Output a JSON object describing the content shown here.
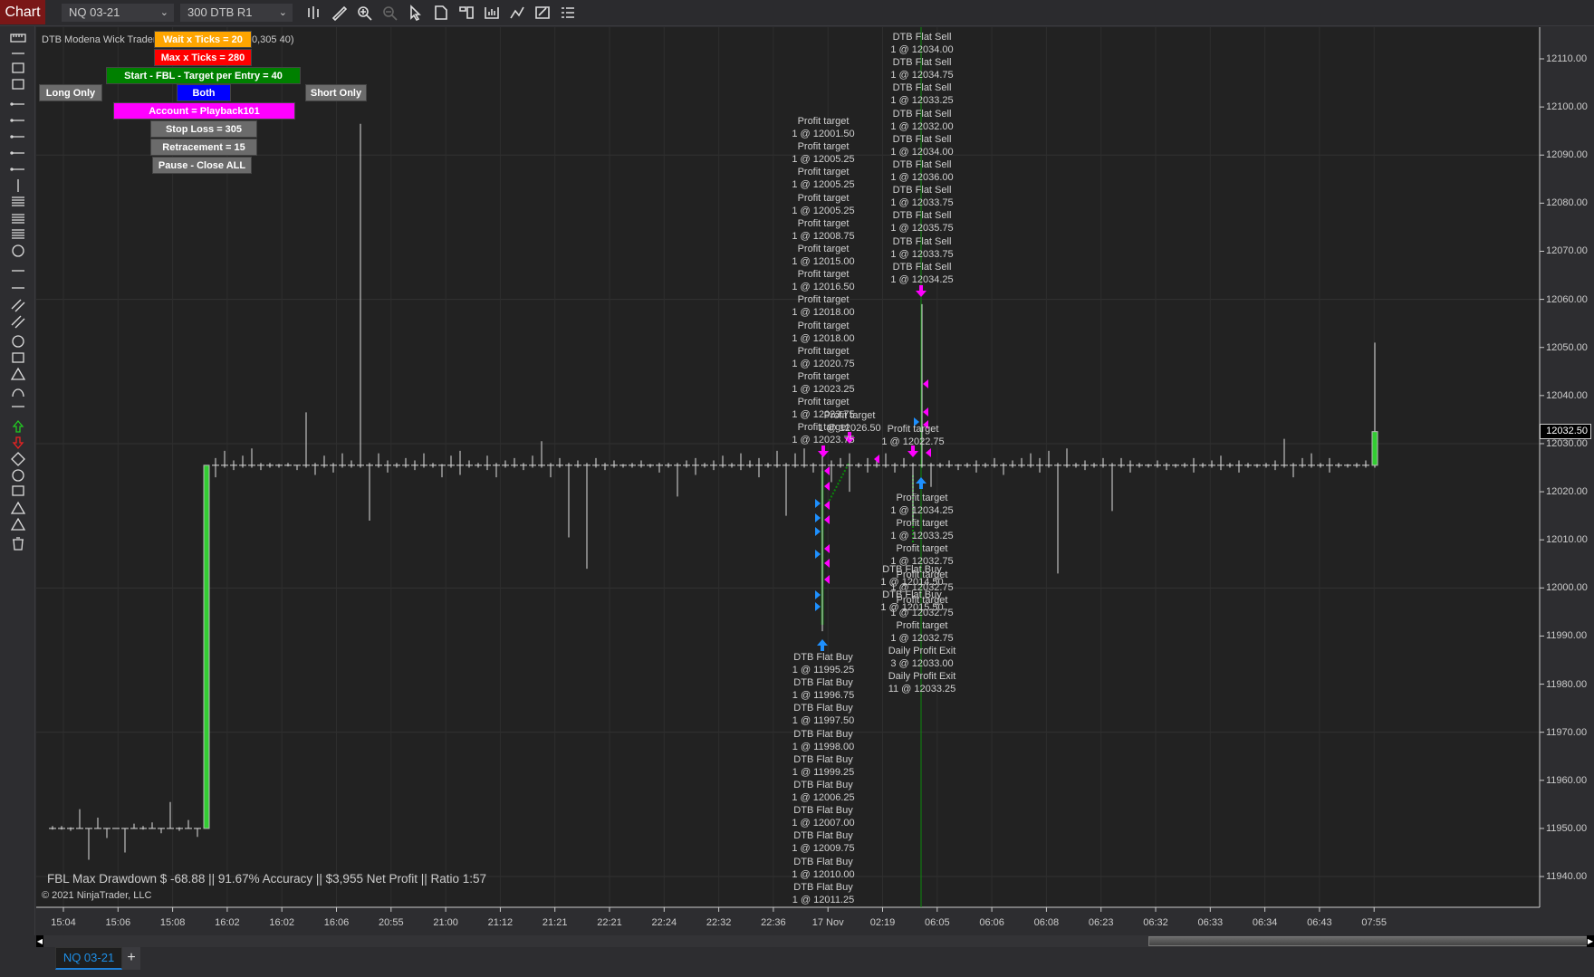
{
  "topbar": {
    "app_button": "Chart",
    "instrument": "NQ 03-21",
    "bar_type": "300 DTB R1",
    "icons": [
      "bar-chart-icon",
      "pencil-icon",
      "zoom-in-icon",
      "zoom-out-icon",
      "pointer-icon",
      "properties-icon",
      "data-box-icon",
      "chart-trader-icon",
      "indicators-icon",
      "strategies-icon",
      "list-icon"
    ]
  },
  "left_toolbar": {
    "icons": [
      "ruler-icon",
      "risk-reward-icon",
      "region-vertical-icon",
      "region-horizontal-icon",
      "line-icon",
      "ray-icon",
      "extended-line-icon",
      "arrow-line-icon",
      "horizontal-line-icon",
      "vertical-line-icon",
      "fib-retracement-icon",
      "fib-extension-icon",
      "fib-time-icon",
      "fib-circle-icon",
      "andrews-pitchfork-icon",
      "gann-fan-icon",
      "regression-channel-icon",
      "trend-channel-icon",
      "ellipse-icon",
      "rectangle-icon",
      "triangle-icon",
      "arc-icon",
      "text-icon",
      "arrow-up-icon",
      "arrow-down-icon",
      "diamond-icon",
      "dot-icon",
      "square-icon",
      "triangle-up-icon",
      "triangle-down-icon",
      "trash-icon"
    ]
  },
  "indicator": {
    "label_left": "DTB Modena Wick Trader,",
    "label_right": "0,305 40)"
  },
  "panel": {
    "wait_ticks": "Wait x Ticks = 20",
    "max_ticks": "Max x Ticks = 280",
    "start": "Start - FBL - Target per Entry = 40",
    "long_only": "Long Only",
    "both": "Both",
    "short_only": "Short Only",
    "account": "Account = Playback101",
    "stop_loss": "Stop Loss = 305",
    "retracement": "Retracement = 15",
    "pause": "Pause - Close ALL"
  },
  "colors": {
    "wait": "#ffa500",
    "max": "#ff0000",
    "start": "#008000",
    "both": "#0000ff",
    "account": "#ff00ff",
    "grey_button": "#6b6b6b",
    "up_bar": "#33cc33",
    "sell_marker": "#ff00ff",
    "buy_marker": "#1e90ff",
    "background": "#222222"
  },
  "price_axis": {
    "ticks": [
      "12110.00",
      "12100.00",
      "12090.00",
      "12080.00",
      "12070.00",
      "12060.00",
      "12050.00",
      "12040.00",
      "12030.00",
      "12020.00",
      "12010.00",
      "12000.00",
      "11990.00",
      "11980.00",
      "11970.00",
      "11960.00",
      "11950.00",
      "11940.00"
    ],
    "current_price": "12032.50"
  },
  "time_axis": [
    "15:04",
    "15:06",
    "15:08",
    "16:02",
    "16:02",
    "16:06",
    "20:55",
    "21:00",
    "21:12",
    "21:21",
    "22:21",
    "22:24",
    "22:32",
    "22:36",
    "17 Nov",
    "02:19",
    "06:05",
    "06:06",
    "06:08",
    "06:23",
    "06:32",
    "06:33",
    "06:34",
    "06:43",
    "07:55"
  ],
  "bars": [
    [
      11950,
      11950.5,
      11949.75,
      11950
    ],
    [
      11950,
      11950.5,
      11949.75,
      11950
    ],
    [
      11950,
      11950.25,
      11949.5,
      11950
    ],
    [
      11950,
      11954,
      11950,
      11950
    ],
    [
      11950,
      11950,
      11943.5,
      11950
    ],
    [
      11950,
      11952.25,
      11950,
      11950
    ],
    [
      11950,
      11950,
      11948,
      11950
    ],
    [
      11950,
      11950,
      11950,
      11950
    ],
    [
      11950,
      11950,
      11945,
      11950
    ],
    [
      11950,
      11951,
      11950,
      11950
    ],
    [
      11950,
      11950.5,
      11949.75,
      11950
    ],
    [
      11950,
      11951.25,
      11950,
      11950
    ],
    [
      11950,
      11950,
      11949,
      11950
    ],
    [
      11950,
      11955.5,
      11950,
      11950
    ],
    [
      11950,
      11950.25,
      11949.5,
      11950
    ],
    [
      11950,
      11951.75,
      11950,
      11950
    ],
    [
      11950,
      11950,
      11948.25,
      11950
    ],
    [
      11950,
      12025.5,
      11950,
      12025.5
    ],
    [
      12025.5,
      12027,
      12023,
      12025.5
    ],
    [
      12025.5,
      12028.5,
      12025,
      12025.5
    ],
    [
      12025.5,
      12026.5,
      12024.5,
      12025.5
    ],
    [
      12025.5,
      12027.5,
      12025,
      12025.5
    ],
    [
      12025.5,
      12029,
      12025,
      12025.5
    ],
    [
      12025.5,
      12026,
      12024.5,
      12025.5
    ],
    [
      12025.5,
      12026,
      12025,
      12025.5
    ],
    [
      12025.5,
      12025.75,
      12025,
      12025.5
    ],
    [
      12025.5,
      12026,
      12025.25,
      12025.5
    ],
    [
      12025.5,
      12025.5,
      12024.5,
      12025.5
    ],
    [
      12025.5,
      12036.5,
      12025,
      12025.5
    ],
    [
      12025.5,
      12026,
      12023.5,
      12025.5
    ],
    [
      12025.5,
      12027.5,
      12025,
      12025.5
    ],
    [
      12025.5,
      12026,
      12024,
      12025.5
    ],
    [
      12025.5,
      12028,
      12025,
      12025.5
    ],
    [
      12025.5,
      12026.5,
      12025,
      12025.5
    ],
    [
      12025.5,
      12096.5,
      12025,
      12025.5
    ],
    [
      12025.5,
      12026,
      12014,
      12025.5
    ],
    [
      12025.5,
      12028,
      12025,
      12025.5
    ],
    [
      12025.5,
      12026.5,
      12024,
      12025.5
    ],
    [
      12025.5,
      12026,
      12025,
      12025.5
    ],
    [
      12025.5,
      12027,
      12025,
      12025.5
    ],
    [
      12025.5,
      12026.5,
      12024.5,
      12025.5
    ],
    [
      12025.5,
      12028,
      12025,
      12025.5
    ],
    [
      12025.5,
      12026,
      12025,
      12025.5
    ],
    [
      12025.5,
      12025.75,
      12023,
      12025.5
    ],
    [
      12025.5,
      12027.5,
      12025,
      12025.5
    ],
    [
      12025.5,
      12028.5,
      12023.5,
      12025.5
    ],
    [
      12025.5,
      12026.5,
      12025,
      12025.5
    ],
    [
      12025.5,
      12026,
      12025,
      12025.5
    ],
    [
      12025.5,
      12027.5,
      12024.5,
      12025.5
    ],
    [
      12025.5,
      12026,
      12023,
      12025.5
    ],
    [
      12025.5,
      12026.5,
      12025,
      12025.5
    ],
    [
      12025.5,
      12027,
      12025,
      12025.5
    ],
    [
      12025.5,
      12026,
      12024.5,
      12025.5
    ],
    [
      12025.5,
      12027.5,
      12025,
      12025.5
    ],
    [
      12025.5,
      12030.5,
      12025,
      12025.5
    ],
    [
      12025.5,
      12026,
      12023,
      12025.5
    ],
    [
      12025.5,
      12027,
      12025,
      12025.5
    ],
    [
      12025.5,
      12026,
      12010.5,
      12025.5
    ],
    [
      12025.5,
      12026.5,
      12025,
      12025.5
    ],
    [
      12025.5,
      12026,
      12004,
      12025.5
    ],
    [
      12025.5,
      12027,
      12025,
      12025.5
    ],
    [
      12025.5,
      12026,
      12024.5,
      12025.5
    ],
    [
      12025.5,
      12026.5,
      12025,
      12025.5
    ],
    [
      12025.5,
      12025.75,
      12025,
      12025.5
    ],
    [
      12025.5,
      12026,
      12025,
      12025.5
    ],
    [
      12025.5,
      12026.5,
      12025,
      12025.5
    ],
    [
      12025.5,
      12025.75,
      12025,
      12025.5
    ],
    [
      12025.5,
      12026,
      12024,
      12025.5
    ],
    [
      12025.5,
      12026,
      12025,
      12025.5
    ],
    [
      12025.5,
      12026,
      12019,
      12025.5
    ],
    [
      12025.5,
      12026.5,
      12025,
      12025.5
    ],
    [
      12025.5,
      12027,
      12023.5,
      12025.5
    ],
    [
      12025.5,
      12026,
      12025,
      12025.5
    ],
    [
      12025.5,
      12026.5,
      12024.5,
      12025.5
    ],
    [
      12025.5,
      12027.5,
      12025,
      12025.5
    ],
    [
      12025.5,
      12026,
      12025,
      12025.5
    ],
    [
      12025.5,
      12028,
      12024.5,
      12025.5
    ],
    [
      12025.5,
      12026.5,
      12025,
      12025.5
    ],
    [
      12025.5,
      12027,
      12023,
      12025.5
    ],
    [
      12025.5,
      12026,
      12025,
      12025.5
    ],
    [
      12025.5,
      12028.5,
      12025,
      12025.5
    ],
    [
      12025.5,
      12026,
      12015,
      12025.5
    ],
    [
      12025.5,
      12028,
      12025,
      12025.5
    ],
    [
      12025.5,
      12029,
      12025,
      12025.5
    ],
    [
      12025.5,
      12026,
      12024,
      12025.5
    ],
    [
      12025.5,
      12028,
      11991,
      12025.5
    ],
    [
      12025.5,
      12026.5,
      12022,
      12025.5
    ],
    [
      12025.5,
      12027,
      12025,
      12025.5
    ],
    [
      12025.5,
      12028,
      12020,
      12025.5
    ],
    [
      12025.5,
      12026,
      12025,
      12025.5
    ],
    [
      12025.5,
      12027,
      12024,
      12025.5
    ],
    [
      12025.5,
      12026.5,
      12025,
      12025.5
    ],
    [
      12025.5,
      12028,
      12025,
      12025.5
    ],
    [
      12025.5,
      12026,
      12024,
      12025.5
    ],
    [
      12025.5,
      12027,
      12025,
      12025.5
    ],
    [
      12025.5,
      12026,
      12014,
      12025.5
    ],
    [
      12025.5,
      12059,
      12025,
      12025.5
    ],
    [
      12025.5,
      12026,
      12021,
      12025.5
    ],
    [
      12025.5,
      12026,
      12025,
      12025.5
    ],
    [
      12025.5,
      12026.5,
      12025,
      12025.5
    ],
    [
      12025.5,
      12025.75,
      12024.5,
      12025.5
    ],
    [
      12025.5,
      12026,
      12025,
      12025.5
    ],
    [
      12025.5,
      12026.5,
      12024,
      12025.5
    ],
    [
      12025.5,
      12026,
      12025,
      12025.5
    ],
    [
      12025.5,
      12027,
      12025,
      12025.5
    ],
    [
      12025.5,
      12026,
      12023.5,
      12025.5
    ],
    [
      12025.5,
      12026.5,
      12025,
      12025.5
    ],
    [
      12025.5,
      12027,
      12025,
      12025.5
    ],
    [
      12025.5,
      12028,
      12025,
      12025.5
    ],
    [
      12025.5,
      12027,
      12024,
      12025.5
    ],
    [
      12025.5,
      12028.5,
      12025,
      12025.5
    ],
    [
      12025.5,
      12026,
      12003,
      12025.5
    ],
    [
      12025.5,
      12029,
      12025,
      12025.5
    ],
    [
      12025.5,
      12026,
      12025,
      12025.5
    ],
    [
      12025.5,
      12026.5,
      12024.5,
      12025.5
    ],
    [
      12025.5,
      12026,
      12025,
      12025.5
    ],
    [
      12025.5,
      12027,
      12025,
      12025.5
    ],
    [
      12025.5,
      12026,
      12016,
      12025.5
    ],
    [
      12025.5,
      12027,
      12025,
      12025.5
    ],
    [
      12025.5,
      12026.5,
      12024,
      12025.5
    ],
    [
      12025.5,
      12026,
      12025,
      12025.5
    ],
    [
      12025.5,
      12025.75,
      12025,
      12025.5
    ],
    [
      12025.5,
      12026.5,
      12025,
      12025.5
    ],
    [
      12025.5,
      12026,
      12024.5,
      12025.5
    ],
    [
      12025.5,
      12025.75,
      12025,
      12025.5
    ],
    [
      12025.5,
      12026,
      12025,
      12025.5
    ],
    [
      12025.5,
      12027,
      12024,
      12025.5
    ],
    [
      12025.5,
      12026,
      12025,
      12025.5
    ],
    [
      12025.5,
      12026.5,
      12025,
      12025.5
    ],
    [
      12025.5,
      12027.5,
      12024.5,
      12025.5
    ],
    [
      12025.5,
      12026,
      12025,
      12025.5
    ],
    [
      12025.5,
      12026.5,
      12024,
      12025.5
    ],
    [
      12025.5,
      12026,
      12025,
      12025.5
    ],
    [
      12025.5,
      12025.75,
      12025,
      12025.5
    ],
    [
      12025.5,
      12026,
      12025,
      12025.5
    ],
    [
      12025.5,
      12026.5,
      12024.5,
      12025.5
    ],
    [
      12025.5,
      12031,
      12025,
      12025.5
    ],
    [
      12025.5,
      12026,
      12023,
      12025.5
    ],
    [
      12025.5,
      12027,
      12025,
      12025.5
    ],
    [
      12025.5,
      12028,
      12025,
      12025.5
    ],
    [
      12025.5,
      12026,
      12025,
      12025.5
    ],
    [
      12025.5,
      12027,
      12024,
      12025.5
    ],
    [
      12025.5,
      12026,
      12025,
      12025.5
    ],
    [
      12025.5,
      12025.75,
      12025,
      12025.5
    ],
    [
      12025.5,
      12026,
      12025,
      12025.5
    ],
    [
      12025.5,
      12026.5,
      12025,
      12025.5
    ],
    [
      12025.5,
      12051,
      12025,
      12032.5
    ]
  ],
  "annotations": {
    "profit_targets_a": [
      {
        "label": "Profit target",
        "fill": "1 @ 12001.50"
      },
      {
        "label": "Profit target",
        "fill": "1 @ 12005.25"
      },
      {
        "label": "Profit target",
        "fill": "1 @ 12005.25"
      },
      {
        "label": "Profit target",
        "fill": "1 @ 12005.25"
      },
      {
        "label": "Profit target",
        "fill": "1 @ 12008.75"
      },
      {
        "label": "Profit target",
        "fill": "1 @ 12015.00"
      },
      {
        "label": "Profit target",
        "fill": "1 @ 12016.50"
      },
      {
        "label": "Profit target",
        "fill": "1 @ 12018.00"
      },
      {
        "label": "Profit target",
        "fill": "1 @ 12018.00"
      },
      {
        "label": "Profit target",
        "fill": "1 @ 12020.75"
      },
      {
        "label": "Profit target",
        "fill": "1 @ 12023.25"
      },
      {
        "label": "Profit target",
        "fill": "1 @ 12023.75"
      },
      {
        "label": "Profit target",
        "fill": "1 @ 12023.75"
      }
    ],
    "profit_target_extra_1": {
      "label": "Profit target",
      "fill": "1 @ 12026.50"
    },
    "profit_target_extra_2": {
      "label": "Profit target",
      "fill": "1 @ 12022.75"
    },
    "flat_sells": [
      {
        "label": "DTB Flat Sell",
        "fill": "1 @ 12034.00"
      },
      {
        "label": "DTB Flat Sell",
        "fill": "1 @ 12034.75"
      },
      {
        "label": "DTB Flat Sell",
        "fill": "1 @ 12033.25"
      },
      {
        "label": "DTB Flat Sell",
        "fill": "1 @ 12032.00"
      },
      {
        "label": "DTB Flat Sell",
        "fill": "1 @ 12034.00"
      },
      {
        "label": "DTB Flat Sell",
        "fill": "1 @ 12036.00"
      },
      {
        "label": "DTB Flat Sell",
        "fill": "1 @ 12033.75"
      },
      {
        "label": "DTB Flat Sell",
        "fill": "1 @ 12035.75"
      },
      {
        "label": "DTB Flat Sell",
        "fill": "1 @ 12033.75"
      },
      {
        "label": "DTB Flat Sell",
        "fill": "1 @ 12034.25"
      }
    ],
    "profit_targets_c": [
      {
        "label": "Profit target",
        "fill": "1 @ 12034.25"
      },
      {
        "label": "Profit target",
        "fill": "1 @ 12033.25"
      },
      {
        "label": "Profit target",
        "fill": "1 @ 12032.75"
      },
      {
        "label": "Profit target",
        "fill": "1 @ 12032.75"
      },
      {
        "label": "Profit target",
        "fill": "1 @ 12032.75"
      },
      {
        "label": "Profit target",
        "fill": "1 @ 12032.75"
      },
      {
        "label": "Daily Profit Exit",
        "fill": "3 @ 12033.00"
      },
      {
        "label": "Daily Profit Exit",
        "fill": "11 @ 12033.25"
      }
    ],
    "flat_buys_mid": [
      {
        "label": "DTB Flat Buy",
        "fill": "1 @ 12014.50"
      },
      {
        "label": "DTB Flat Buy",
        "fill": "1 @ 12015.50"
      }
    ],
    "flat_buys": [
      {
        "label": "DTB Flat Buy",
        "fill": "1 @ 11995.25"
      },
      {
        "label": "DTB Flat Buy",
        "fill": "1 @ 11996.75"
      },
      {
        "label": "DTB Flat Buy",
        "fill": "1 @ 11997.50"
      },
      {
        "label": "DTB Flat Buy",
        "fill": "1 @ 11998.00"
      },
      {
        "label": "DTB Flat Buy",
        "fill": "1 @ 11999.25"
      },
      {
        "label": "DTB Flat Buy",
        "fill": "1 @ 12006.25"
      },
      {
        "label": "DTB Flat Buy",
        "fill": "1 @ 12007.00"
      },
      {
        "label": "DTB Flat Buy",
        "fill": "1 @ 12009.75"
      },
      {
        "label": "DTB Flat Buy",
        "fill": "1 @ 12010.00"
      },
      {
        "label": "DTB Flat Buy",
        "fill": "1 @ 12011.25"
      }
    ]
  },
  "footer": {
    "stats": "FBL Max Drawdown $ -68.88 || 91.67% Accuracy  || $3,955 Net Profit || Ratio 1:57",
    "copyright": "© 2021 NinjaTrader, LLC"
  },
  "tabs": [
    {
      "label": "NQ 03-21",
      "active": true
    }
  ],
  "add_tab": "+"
}
